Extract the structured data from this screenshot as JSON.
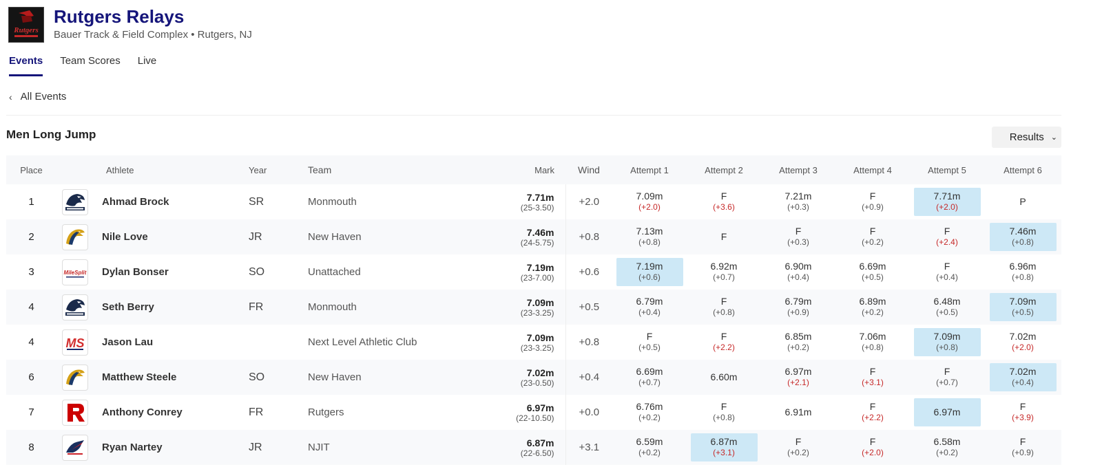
{
  "meet": {
    "title": "Rutgers Relays",
    "venue": "Bauer Track & Field Complex • Rutgers, NJ",
    "logo_text": "Rutgers"
  },
  "tabs": [
    {
      "label": "Events",
      "active": true
    },
    {
      "label": "Team Scores",
      "active": false
    },
    {
      "label": "Live",
      "active": false
    }
  ],
  "back_link": "All Events",
  "event": {
    "title": "Men Long Jump",
    "view_select": "Results"
  },
  "columns": {
    "place": "Place",
    "athlete": "Athlete",
    "year": "Year",
    "team": "Team",
    "mark": "Mark",
    "wind": "Wind",
    "attempts": [
      "Attempt 1",
      "Attempt 2",
      "Attempt 3",
      "Attempt 4",
      "Attempt 5",
      "Attempt 6"
    ]
  },
  "rows": [
    {
      "place": "1",
      "name": "Ahmad Brock",
      "year": "SR",
      "team": "Monmouth",
      "logo": "monmouth-hawk-icon",
      "mark": "7.71m",
      "mark_imperial": "(25-3.50)",
      "wind": "+2.0",
      "attempts": [
        {
          "v": "7.09m",
          "w": "(+2.0)",
          "red": true,
          "best": false
        },
        {
          "v": "F",
          "w": "(+3.6)",
          "red": true,
          "best": false
        },
        {
          "v": "7.21m",
          "w": "(+0.3)",
          "red": false,
          "best": false
        },
        {
          "v": "F",
          "w": "(+0.9)",
          "red": false,
          "best": false
        },
        {
          "v": "7.71m",
          "w": "(+2.0)",
          "red": true,
          "best": true
        },
        {
          "v": "P",
          "w": "",
          "red": false,
          "best": false
        }
      ]
    },
    {
      "place": "2",
      "name": "Nile Love",
      "year": "JR",
      "team": "New Haven",
      "logo": "new-haven-charger-icon",
      "mark": "7.46m",
      "mark_imperial": "(24-5.75)",
      "wind": "+0.8",
      "attempts": [
        {
          "v": "7.13m",
          "w": "(+0.8)",
          "red": false,
          "best": false
        },
        {
          "v": "F",
          "w": "",
          "red": false,
          "best": false
        },
        {
          "v": "F",
          "w": "(+0.3)",
          "red": false,
          "best": false
        },
        {
          "v": "F",
          "w": "(+0.2)",
          "red": false,
          "best": false
        },
        {
          "v": "F",
          "w": "(+2.4)",
          "red": true,
          "best": false
        },
        {
          "v": "7.46m",
          "w": "(+0.8)",
          "red": false,
          "best": true
        }
      ]
    },
    {
      "place": "3",
      "name": "Dylan Bonser",
      "year": "SO",
      "team": "Unattached",
      "logo": "milesplit-logo-icon",
      "mark": "7.19m",
      "mark_imperial": "(23-7.00)",
      "wind": "+0.6",
      "attempts": [
        {
          "v": "7.19m",
          "w": "(+0.6)",
          "red": false,
          "best": true
        },
        {
          "v": "6.92m",
          "w": "(+0.7)",
          "red": false,
          "best": false
        },
        {
          "v": "6.90m",
          "w": "(+0.4)",
          "red": false,
          "best": false
        },
        {
          "v": "6.69m",
          "w": "(+0.5)",
          "red": false,
          "best": false
        },
        {
          "v": "F",
          "w": "(+0.4)",
          "red": false,
          "best": false
        },
        {
          "v": "6.96m",
          "w": "(+0.8)",
          "red": false,
          "best": false
        }
      ]
    },
    {
      "place": "4",
      "name": "Seth Berry",
      "year": "FR",
      "team": "Monmouth",
      "logo": "monmouth-hawk-icon",
      "mark": "7.09m",
      "mark_imperial": "(23-3.25)",
      "wind": "+0.5",
      "attempts": [
        {
          "v": "6.79m",
          "w": "(+0.4)",
          "red": false,
          "best": false
        },
        {
          "v": "F",
          "w": "(+0.8)",
          "red": false,
          "best": false
        },
        {
          "v": "6.79m",
          "w": "(+0.9)",
          "red": false,
          "best": false
        },
        {
          "v": "6.89m",
          "w": "(+0.2)",
          "red": false,
          "best": false
        },
        {
          "v": "6.48m",
          "w": "(+0.5)",
          "red": false,
          "best": false
        },
        {
          "v": "7.09m",
          "w": "(+0.5)",
          "red": false,
          "best": true
        }
      ]
    },
    {
      "place": "4",
      "name": "Jason Lau",
      "year": "",
      "team": "Next Level Athletic Club",
      "logo": "ms-logo-icon",
      "mark": "7.09m",
      "mark_imperial": "(23-3.25)",
      "wind": "+0.8",
      "attempts": [
        {
          "v": "F",
          "w": "(+0.5)",
          "red": false,
          "best": false
        },
        {
          "v": "F",
          "w": "(+2.2)",
          "red": true,
          "best": false
        },
        {
          "v": "6.85m",
          "w": "(+0.2)",
          "red": false,
          "best": false
        },
        {
          "v": "7.06m",
          "w": "(+0.8)",
          "red": false,
          "best": false
        },
        {
          "v": "7.09m",
          "w": "(+0.8)",
          "red": false,
          "best": true
        },
        {
          "v": "7.02m",
          "w": "(+2.0)",
          "red": true,
          "best": false
        }
      ]
    },
    {
      "place": "6",
      "name": "Matthew Steele",
      "year": "SO",
      "team": "New Haven",
      "logo": "new-haven-charger-icon",
      "mark": "7.02m",
      "mark_imperial": "(23-0.50)",
      "wind": "+0.4",
      "attempts": [
        {
          "v": "6.69m",
          "w": "(+0.7)",
          "red": false,
          "best": false
        },
        {
          "v": "6.60m",
          "w": "",
          "red": false,
          "best": false
        },
        {
          "v": "6.97m",
          "w": "(+2.1)",
          "red": true,
          "best": false
        },
        {
          "v": "F",
          "w": "(+3.1)",
          "red": true,
          "best": false
        },
        {
          "v": "F",
          "w": "(+0.7)",
          "red": false,
          "best": false
        },
        {
          "v": "7.02m",
          "w": "(+0.4)",
          "red": false,
          "best": true
        }
      ]
    },
    {
      "place": "7",
      "name": "Anthony Conrey",
      "year": "FR",
      "team": "Rutgers",
      "logo": "rutgers-r-icon",
      "mark": "6.97m",
      "mark_imperial": "(22-10.50)",
      "wind": "+0.0",
      "attempts": [
        {
          "v": "6.76m",
          "w": "(+0.2)",
          "red": false,
          "best": false
        },
        {
          "v": "F",
          "w": "(+0.8)",
          "red": false,
          "best": false
        },
        {
          "v": "6.91m",
          "w": "",
          "red": false,
          "best": false
        },
        {
          "v": "F",
          "w": "(+2.2)",
          "red": true,
          "best": false
        },
        {
          "v": "6.97m",
          "w": "",
          "red": false,
          "best": true
        },
        {
          "v": "F",
          "w": "(+3.9)",
          "red": true,
          "best": false
        }
      ]
    },
    {
      "place": "8",
      "name": "Ryan Nartey",
      "year": "JR",
      "team": "NJIT",
      "logo": "njit-highlander-icon",
      "mark": "6.87m",
      "mark_imperial": "(22-6.50)",
      "wind": "+3.1",
      "attempts": [
        {
          "v": "6.59m",
          "w": "(+0.2)",
          "red": false,
          "best": false
        },
        {
          "v": "6.87m",
          "w": "(+3.1)",
          "red": true,
          "best": true
        },
        {
          "v": "F",
          "w": "(+0.2)",
          "red": false,
          "best": false
        },
        {
          "v": "F",
          "w": "(+2.0)",
          "red": true,
          "best": false
        },
        {
          "v": "6.58m",
          "w": "(+0.2)",
          "red": false,
          "best": false
        },
        {
          "v": "F",
          "w": "(+0.9)",
          "red": false,
          "best": false
        }
      ]
    }
  ],
  "colors": {
    "brand": "#15157a",
    "best_highlight": "#cde8f6",
    "wind_illegal": "#c62828"
  }
}
